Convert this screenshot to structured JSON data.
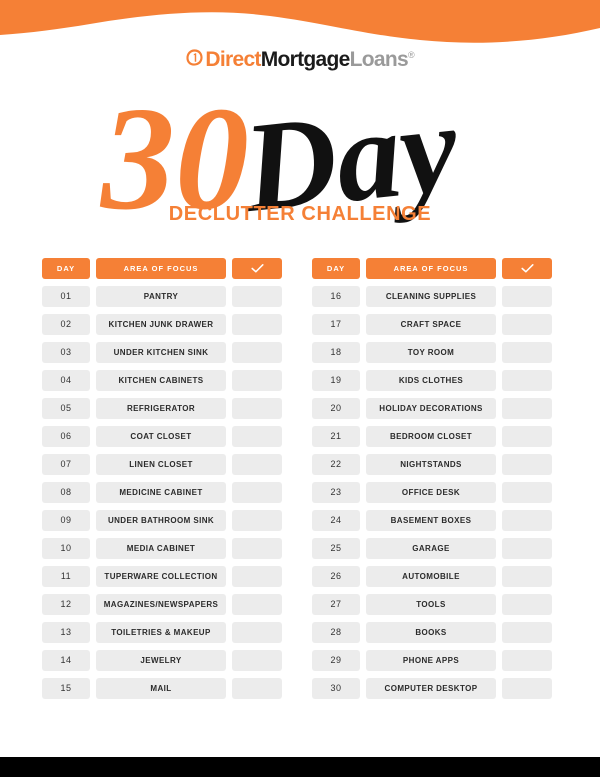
{
  "brand": {
    "logo_direct": "Direct",
    "logo_mortgage": "Mortgage",
    "logo_loans": "Loans",
    "logo_registered": "®",
    "accent_color": "#F58036",
    "dark_color": "#1b1b1b",
    "row_color": "#ECECEC"
  },
  "hero": {
    "number": "30",
    "word": "Day",
    "subtitle": "DECLUTTER CHALLENGE"
  },
  "table": {
    "headers": {
      "day": "DAY",
      "area": "AREA OF FOCUS",
      "check_icon": "checkmark-icon"
    },
    "left_rows": [
      {
        "day": "01",
        "area": "PANTRY"
      },
      {
        "day": "02",
        "area": "KITCHEN JUNK DRAWER"
      },
      {
        "day": "03",
        "area": "UNDER KITCHEN SINK"
      },
      {
        "day": "04",
        "area": "KITCHEN CABINETS"
      },
      {
        "day": "05",
        "area": "REFRIGERATOR"
      },
      {
        "day": "06",
        "area": "COAT CLOSET"
      },
      {
        "day": "07",
        "area": "LINEN CLOSET"
      },
      {
        "day": "08",
        "area": "MEDICINE CABINET"
      },
      {
        "day": "09",
        "area": "UNDER BATHROOM SINK"
      },
      {
        "day": "10",
        "area": "MEDIA CABINET"
      },
      {
        "day": "11",
        "area": "TUPERWARE COLLECTION"
      },
      {
        "day": "12",
        "area": "MAGAZINES/NEWSPAPERS"
      },
      {
        "day": "13",
        "area": "TOILETRIES & MAKEUP"
      },
      {
        "day": "14",
        "area": "JEWELRY"
      },
      {
        "day": "15",
        "area": "MAIL"
      }
    ],
    "right_rows": [
      {
        "day": "16",
        "area": "CLEANING SUPPLIES"
      },
      {
        "day": "17",
        "area": "CRAFT SPACE"
      },
      {
        "day": "18",
        "area": "TOY ROOM"
      },
      {
        "day": "19",
        "area": "KIDS CLOTHES"
      },
      {
        "day": "20",
        "area": "HOLIDAY DECORATIONS"
      },
      {
        "day": "21",
        "area": "BEDROOM CLOSET"
      },
      {
        "day": "22",
        "area": "NIGHTSTANDS"
      },
      {
        "day": "23",
        "area": "OFFICE DESK"
      },
      {
        "day": "24",
        "area": "BASEMENT BOXES"
      },
      {
        "day": "25",
        "area": "GARAGE"
      },
      {
        "day": "26",
        "area": "AUTOMOBILE"
      },
      {
        "day": "27",
        "area": "TOOLS"
      },
      {
        "day": "28",
        "area": "BOOKS"
      },
      {
        "day": "29",
        "area": "PHONE APPS"
      },
      {
        "day": "30",
        "area": "COMPUTER DESKTOP"
      }
    ]
  }
}
